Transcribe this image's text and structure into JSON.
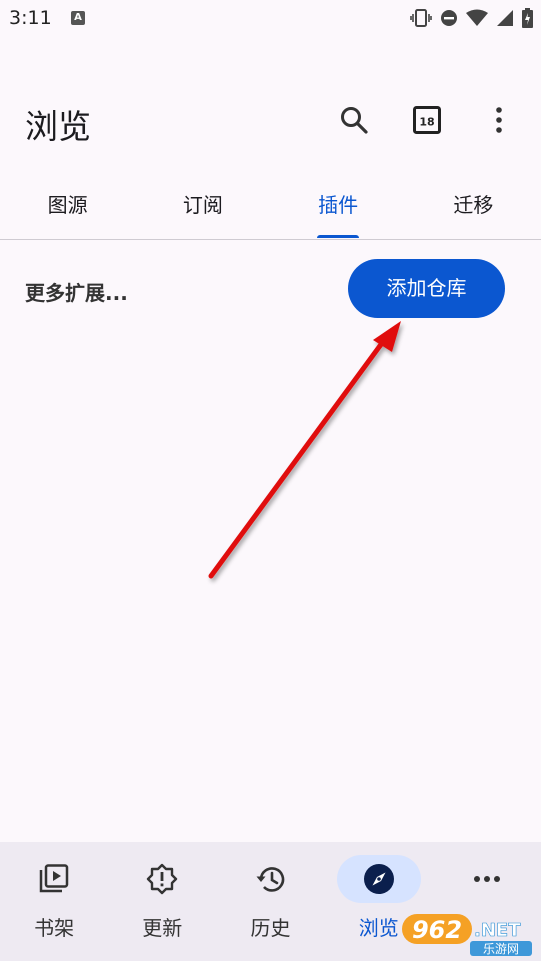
{
  "status_bar": {
    "time": "3:11",
    "notification_letter": "A"
  },
  "app_bar": {
    "title": "浏览",
    "search_icon": "search-icon",
    "calendar_icon": "calendar-icon",
    "calendar_text": "18",
    "more_icon": "more-vert-icon"
  },
  "tabs": [
    {
      "label": "图源",
      "active": false
    },
    {
      "label": "订阅",
      "active": false
    },
    {
      "label": "插件",
      "active": true
    },
    {
      "label": "迁移",
      "active": false
    }
  ],
  "content": {
    "more_extensions": "更多扩展...",
    "add_repo_button": "添加仓库"
  },
  "bottom_nav": [
    {
      "label": "书架",
      "icon": "library-icon",
      "active": false
    },
    {
      "label": "更新",
      "icon": "updates-icon",
      "active": false
    },
    {
      "label": "历史",
      "icon": "history-icon",
      "active": false
    },
    {
      "label": "浏览",
      "icon": "compass-icon",
      "active": true
    },
    {
      "label": "",
      "icon": "more-horiz-icon",
      "active": false
    }
  ],
  "watermark": {
    "number": "962",
    "suffix": ".NET",
    "subtitle": "乐游网"
  },
  "colors": {
    "accent": "#0b57d0",
    "annotation_arrow": "#e01010",
    "background": "#fcf8fc"
  }
}
